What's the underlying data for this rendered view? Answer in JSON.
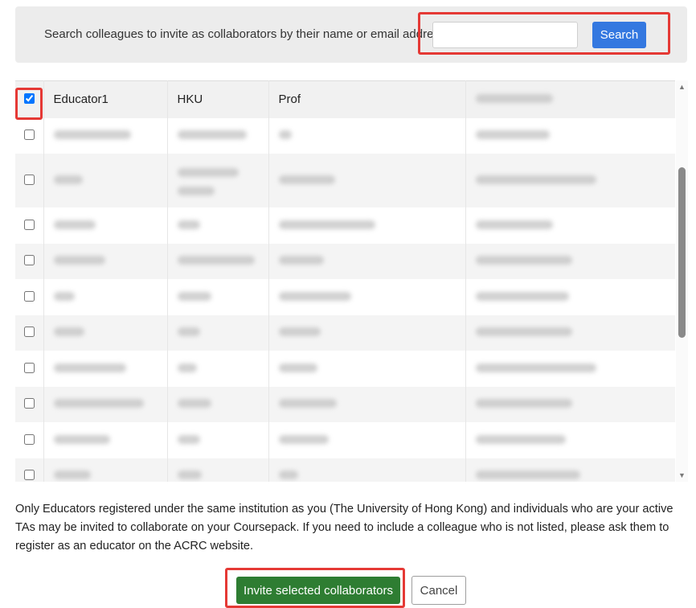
{
  "search": {
    "label": "Search colleagues to invite as collaborators by their name or email address",
    "input_value": "",
    "button_label": "Search"
  },
  "table": {
    "rows": [
      {
        "checked": true,
        "name": "Educator1",
        "institution": "HKU",
        "title": "Prof",
        "blurred_email": true
      },
      {
        "checked": false,
        "blurred": true
      },
      {
        "checked": false,
        "blurred": true,
        "tall": true
      },
      {
        "checked": false,
        "blurred": true
      },
      {
        "checked": false,
        "blurred": true
      },
      {
        "checked": false,
        "blurred": true
      },
      {
        "checked": false,
        "blurred": true
      },
      {
        "checked": false,
        "blurred": true
      },
      {
        "checked": false,
        "blurred": true
      },
      {
        "checked": false,
        "blurred": true
      },
      {
        "checked": false,
        "blurred": true
      }
    ]
  },
  "notice": "Only Educators registered under the same institution as you (The University of Hong Kong) and individuals who are your active TAs may be invited to collaborate on your Coursepack. If you need to include a colleague who is not listed, please ask them to register as an educator on the ACRC website.",
  "actions": {
    "invite_label": "Invite selected collaborators",
    "cancel_label": "Cancel"
  },
  "colors": {
    "search_button": "#3478e0",
    "invite_button": "#2e7d32",
    "highlight": "#e53935"
  }
}
